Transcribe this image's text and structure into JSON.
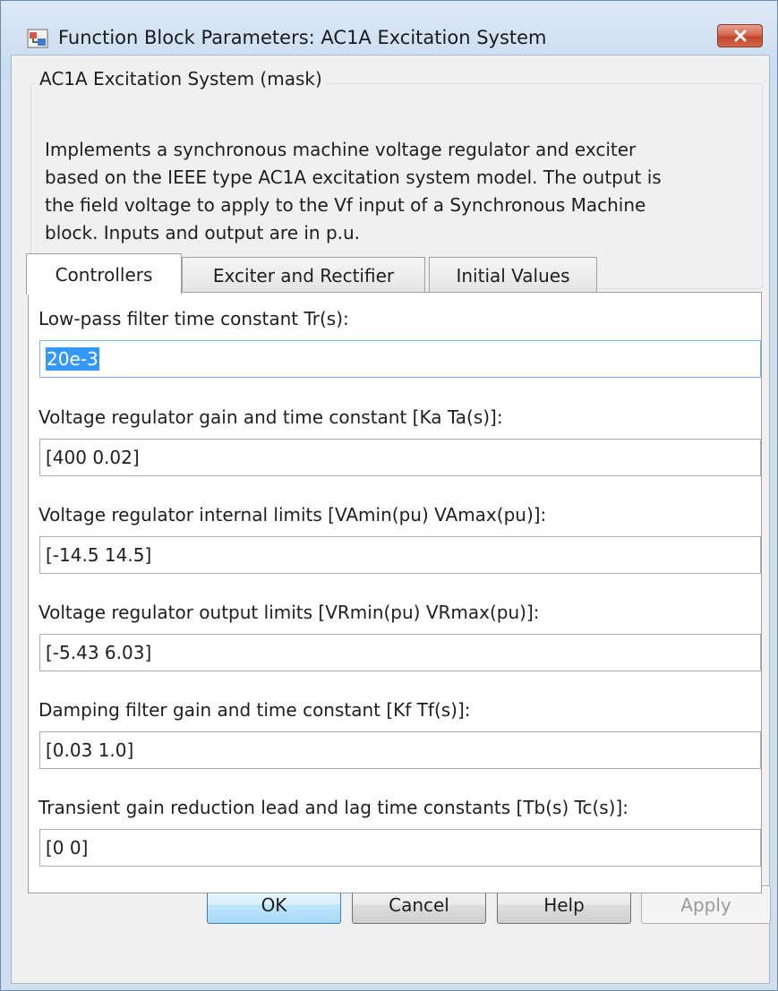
{
  "window": {
    "title": "Function Block Parameters: AC1A Excitation System",
    "icon": "simulink-block-icon",
    "close_icon": "close-x-icon"
  },
  "description": {
    "group_title": "AC1A Excitation System (mask)",
    "lines": [
      "Implements a synchronous machine voltage regulator and exciter",
      "based on the IEEE type AC1A excitation system model. The output is",
      "the field voltage to apply to the Vf input of a Synchronous Machine",
      "block. Inputs and output are in p.u."
    ]
  },
  "tabs": [
    {
      "label": "Controllers",
      "active": true
    },
    {
      "label": "Exciter and Rectifier",
      "active": false
    },
    {
      "label": "Initial Values",
      "active": false
    }
  ],
  "params": [
    {
      "label": "Low-pass filter time constant Tr(s):",
      "value": "20e-3"
    },
    {
      "label": "Voltage regulator gain and time constant [Ka Ta(s)]:",
      "value": "[400 0.02]"
    },
    {
      "label": "Voltage regulator internal limits [VAmin(pu) VAmax(pu)]:",
      "value": "[-14.5 14.5]"
    },
    {
      "label": "Voltage regulator output limits [VRmin(pu) VRmax(pu)]:",
      "value": "[-5.43 6.03]"
    },
    {
      "label": "Damping filter gain and time constant [Kf Tf(s)]:",
      "value": "[0.03 1.0]"
    },
    {
      "label": "Transient gain reduction lead and lag time constants [Tb(s) Tc(s)]:",
      "value": "[0 0]"
    }
  ],
  "buttons": {
    "ok": "OK",
    "cancel": "Cancel",
    "help": "Help",
    "apply": "Apply"
  },
  "colors": {
    "selection": "#3399ff",
    "close_button": "#c2462a",
    "default_button": "#bee6fd"
  }
}
